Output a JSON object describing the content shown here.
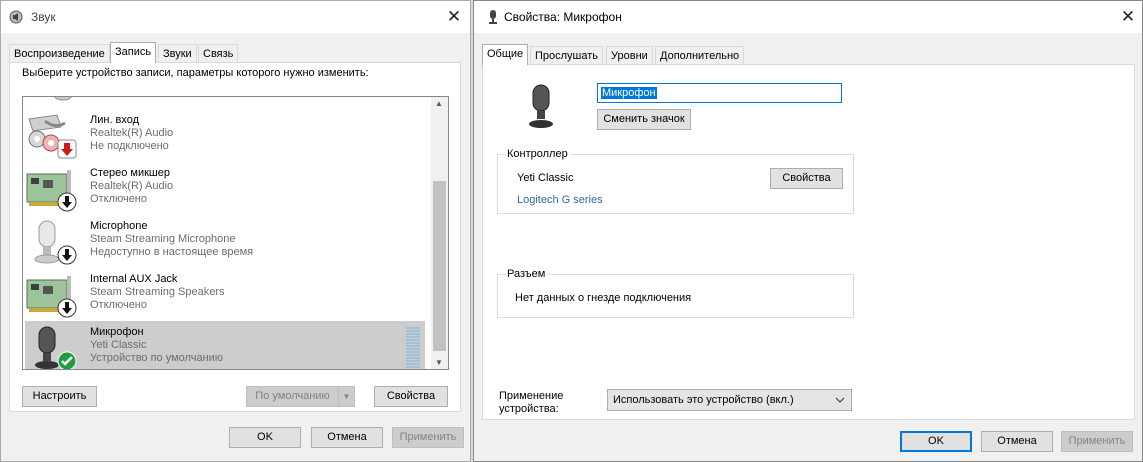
{
  "sound": {
    "title": "Звук",
    "close_icon": "close-icon",
    "tabs": [
      "Воспроизведение",
      "Запись",
      "Звуки",
      "Связь"
    ],
    "active_tab": 1,
    "instruction": "Выберите устройство записи, параметры которого нужно изменить:",
    "devices": [
      {
        "name": "Лин. вход",
        "sub": "Realtek(R) Audio",
        "status": "Не подключено",
        "icon": "line-in-icon",
        "badge": "disconnected-badge-icon"
      },
      {
        "name": "Стерео микшер",
        "sub": "Realtek(R) Audio",
        "status": "Отключено",
        "icon": "sound-card-icon",
        "badge": "disabled-badge-icon"
      },
      {
        "name": "Microphone",
        "sub": "Steam Streaming Microphone",
        "status": "Недоступно в настоящее время",
        "icon": "microphone-icon",
        "badge": "disabled-badge-icon"
      },
      {
        "name": "Internal AUX Jack",
        "sub": "Steam Streaming Speakers",
        "status": "Отключено",
        "icon": "sound-card-icon",
        "badge": "disabled-badge-icon"
      },
      {
        "name": "Микрофон",
        "sub": "Yeti Classic",
        "status": "Устройство по умолчанию",
        "icon": "microphone-icon",
        "badge": "default-check-icon"
      }
    ],
    "buttons": {
      "configure": "Настроить",
      "set_default": "По умолчанию",
      "properties": "Свойства",
      "ok": "OK",
      "cancel": "Отмена",
      "apply": "Применить"
    }
  },
  "props": {
    "title": "Свойства: Микрофон",
    "tabs": [
      "Общие",
      "Прослушать",
      "Уровни",
      "Дополнительно"
    ],
    "active_tab": 0,
    "device_name_value": "Микрофон",
    "change_icon": "Сменить значок",
    "controller": {
      "title": "Контроллер",
      "name": "Yeti Classic",
      "properties": "Свойства",
      "link": "Logitech G series"
    },
    "jack": {
      "title": "Разъем",
      "text": "Нет данных о гнезде подключения"
    },
    "usage": {
      "label_line1": "Применение",
      "label_line2": "устройства:",
      "selected": "Использовать это устройство (вкл.)"
    },
    "buttons": {
      "ok": "OK",
      "cancel": "Отмена",
      "apply": "Применить"
    }
  },
  "colors": {
    "accent": "#0078d7",
    "link": "#2e6aa6",
    "check_green": "#1e9e3a",
    "red_arrow": "#d01818"
  }
}
